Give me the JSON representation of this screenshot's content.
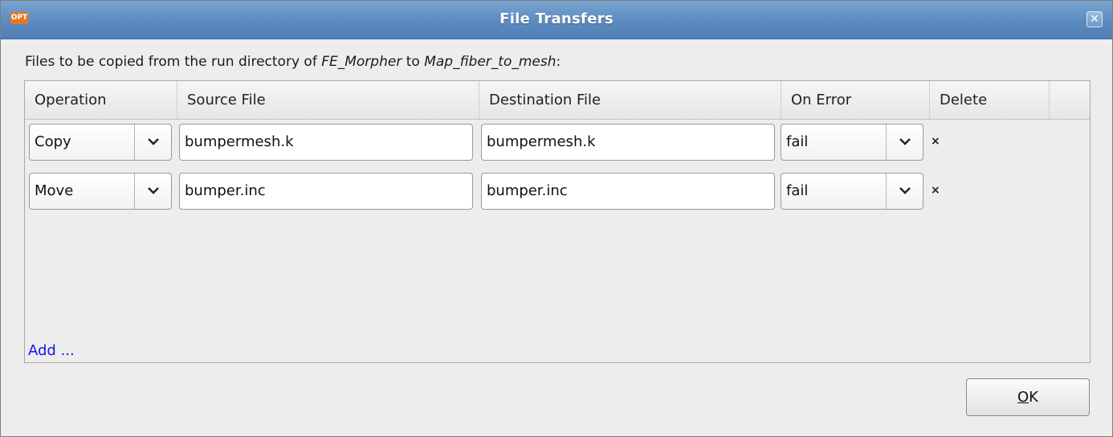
{
  "window": {
    "title": "File Transfers",
    "app_icon_label": "OPT",
    "close_glyph": "✕"
  },
  "description": {
    "prefix": "Files to be copied from the run directory of",
    "source_stage": "FE_Morpher",
    "middle": "to",
    "target_stage": "Map_fiber_to_mesh",
    "suffix": ":"
  },
  "table": {
    "headers": [
      "Operation",
      "Source File",
      "Destination File",
      "On Error",
      "Delete"
    ],
    "rows": [
      {
        "operation": "Copy",
        "source": "bumpermesh.k",
        "destination": "bumpermesh.k",
        "on_error": "fail",
        "delete": "×"
      },
      {
        "operation": "Move",
        "source": "bumper.inc",
        "destination": "bumper.inc",
        "on_error": "fail",
        "delete": "×"
      }
    ],
    "add_label": "Add ..."
  },
  "buttons": {
    "ok_mnemonic": "O",
    "ok_rest": "K"
  },
  "icons": {
    "dropdown": "chevron-down-icon",
    "delete": "close-icon",
    "window_close": "close-icon"
  }
}
